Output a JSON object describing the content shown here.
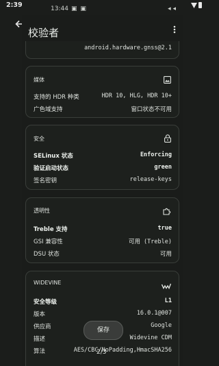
{
  "status_bar": {
    "time": "2:39"
  },
  "embedded_status": {
    "time": "13:44",
    "left_extra": "…",
    "right": "◂ ◂"
  },
  "app_bar": {
    "title": "校验者"
  },
  "cards": {
    "top": {
      "value": "android.hardware.gnss@2.1"
    },
    "media": {
      "header": "媒体",
      "rows": [
        {
          "label": "支持的 HDR 种类",
          "value": "HDR 10, HLG, HDR 10+"
        },
        {
          "label": "广色域支持",
          "value": "窗口状态不可用"
        }
      ]
    },
    "security": {
      "header": "安全",
      "rows": [
        {
          "label": "SELinux 状态",
          "value": "Enforcing"
        },
        {
          "label": "验证启动状态",
          "value": "green"
        },
        {
          "label": "签名密钥",
          "value": "release-keys"
        }
      ]
    },
    "treble": {
      "header": "透明性",
      "rows": [
        {
          "label": "Treble 支持",
          "value": "true"
        },
        {
          "label": "GSI 兼容性",
          "value": "可用 (Treble)"
        },
        {
          "label": "DSU 状态",
          "value": "可用"
        }
      ]
    },
    "widevine": {
      "header": "WIDEVINE",
      "rows": [
        {
          "label": "安全等级",
          "value": "L1"
        },
        {
          "label": "版本",
          "value": "16.0.1@007"
        },
        {
          "label": "供应商",
          "value": "Google"
        },
        {
          "label": "描述",
          "value": "Widevine CDM"
        },
        {
          "label": "算法",
          "value": "AES/CBC/NoPadding,HmacSHA256"
        }
      ]
    }
  },
  "save_button": {
    "label": "保存"
  },
  "page_indicator": {
    "text": "2/3"
  }
}
